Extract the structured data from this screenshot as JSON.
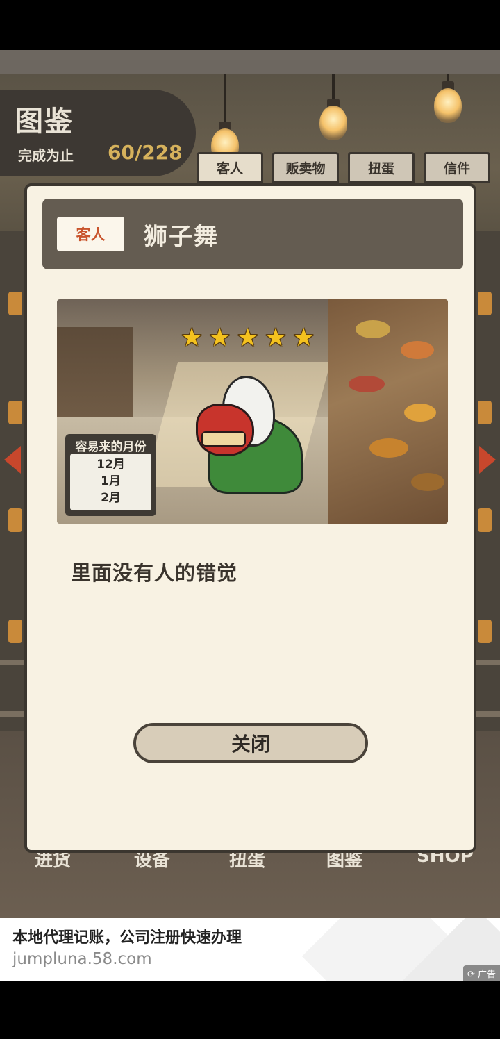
{
  "header": {
    "title": "图鉴",
    "progress_label": "完成为止",
    "progress_value": "60/228"
  },
  "tabs": [
    {
      "label": "客人",
      "active": true
    },
    {
      "label": "贩卖物",
      "active": false
    },
    {
      "label": "扭蛋",
      "active": false
    },
    {
      "label": "信件",
      "active": false
    }
  ],
  "bottom_nav": [
    "进货",
    "设备",
    "扭蛋",
    "图鉴",
    "SHOP"
  ],
  "modal": {
    "category": "客人",
    "name": "狮子舞",
    "rating": 5,
    "rating_stars": "★★★★★",
    "months_label": "容易来的月份",
    "months": [
      "12月",
      "1月",
      "2月"
    ],
    "description": "里面没有人的错觉",
    "close_label": "关闭"
  },
  "ad": {
    "title": "本地代理记账，公司注册快速办理",
    "url": "jumpluna.58.com",
    "tag": "广告"
  },
  "colors": {
    "accent_gold": "#d6b25c",
    "category_red": "#c9542c",
    "modal_bg": "#f8f2e3",
    "header_dark": "#645c51"
  }
}
